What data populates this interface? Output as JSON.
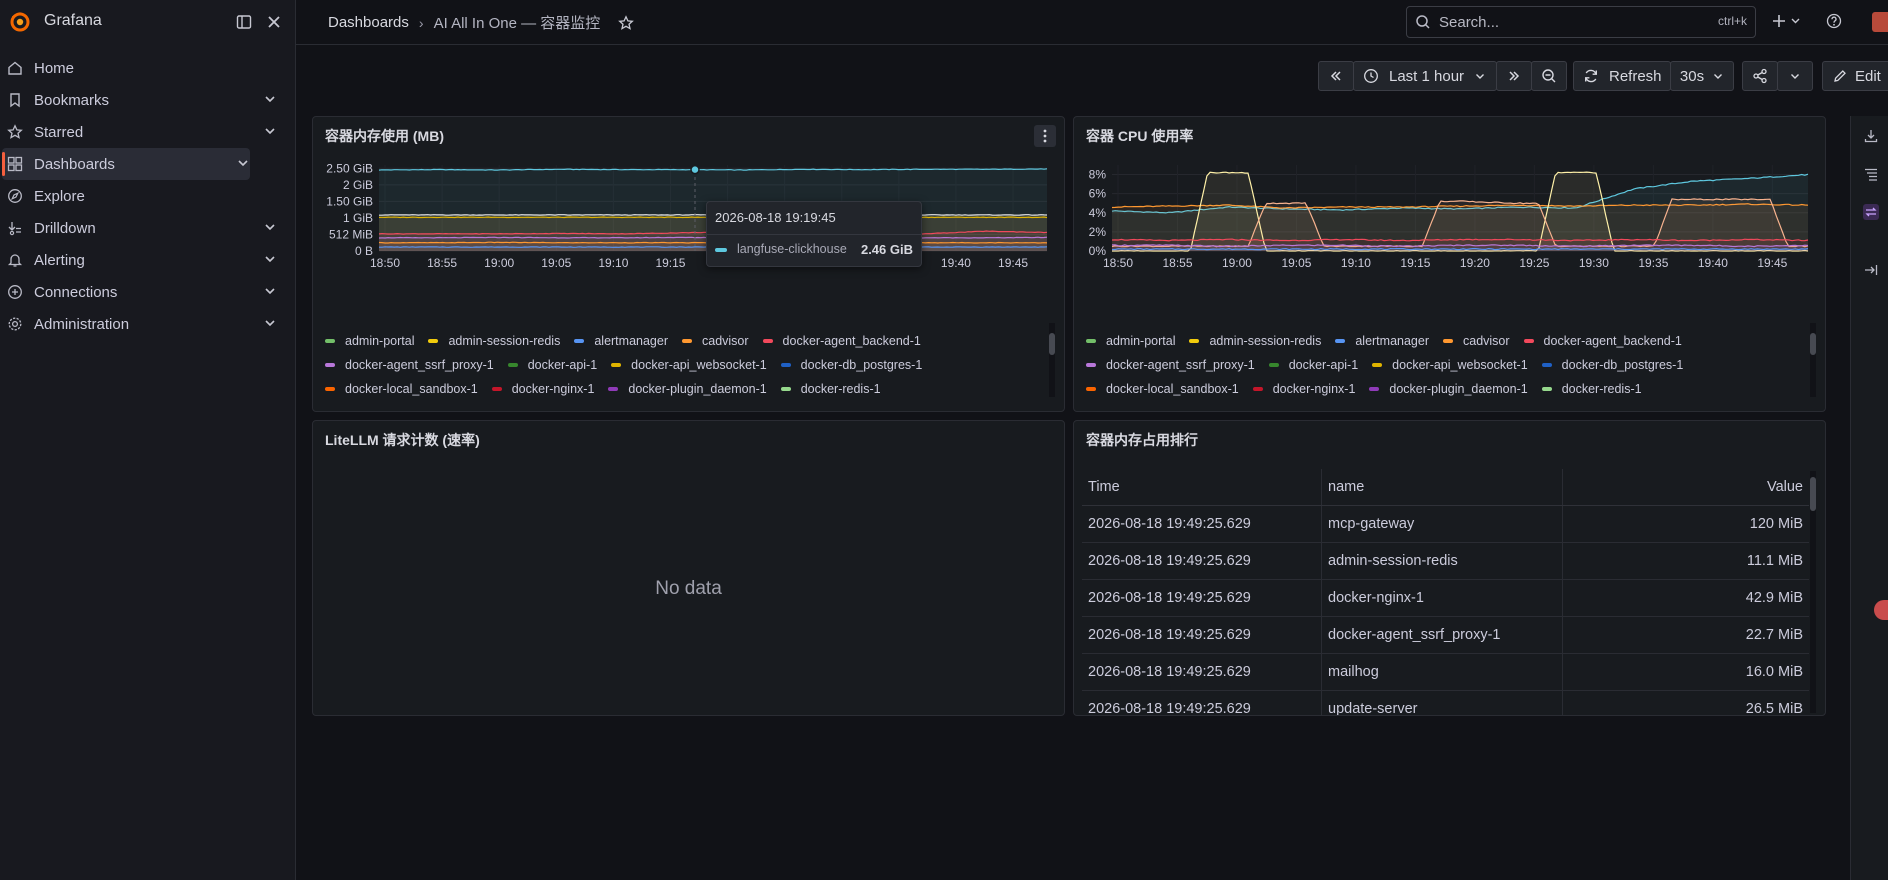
{
  "app": {
    "name": "Grafana"
  },
  "nav": {
    "items": [
      {
        "label": "Home",
        "icon": "home-icon",
        "expandable": false,
        "active": false
      },
      {
        "label": "Bookmarks",
        "icon": "bookmark-icon",
        "expandable": true,
        "active": false
      },
      {
        "label": "Starred",
        "icon": "star-icon",
        "expandable": true,
        "active": false
      },
      {
        "label": "Dashboards",
        "icon": "dashboards-grid-icon",
        "expandable": true,
        "active": true
      },
      {
        "label": "Explore",
        "icon": "compass-icon",
        "expandable": false,
        "active": false
      },
      {
        "label": "Drilldown",
        "icon": "drilldown-icon",
        "expandable": true,
        "active": false
      },
      {
        "label": "Alerting",
        "icon": "bell-icon",
        "expandable": true,
        "active": false
      },
      {
        "label": "Connections",
        "icon": "connections-icon",
        "expandable": true,
        "active": false
      },
      {
        "label": "Administration",
        "icon": "gear-icon",
        "expandable": true,
        "active": false
      }
    ]
  },
  "breadcrumb": {
    "parent": "Dashboards",
    "separator": "›",
    "current": "AI All In One — 容器监控"
  },
  "search": {
    "placeholder": "Search...",
    "shortcut": "ctrl+k"
  },
  "toolbar": {
    "time_range": "Last 1 hour",
    "refresh_label": "Refresh",
    "refresh_interval": "30s",
    "edit_label": "Edit"
  },
  "panels": {
    "memory": {
      "title": "容器内存使用 (MB)",
      "tooltip": {
        "time": "2026-08-18 19:19:45",
        "series": "langfuse-clickhouse",
        "value": "2.46 GiB"
      },
      "legend": [
        [
          "admin-portal",
          "admin-session-redis",
          "alertmanager",
          "cadvisor",
          "docker-agent_backend-1"
        ],
        [
          "docker-agent_ssrf_proxy-1",
          "docker-api-1",
          "docker-api_websocket-1",
          "docker-db_postgres-1"
        ],
        [
          "docker-local_sandbox-1",
          "docker-nginx-1",
          "docker-plugin_daemon-1",
          "docker-redis-1"
        ]
      ]
    },
    "cpu": {
      "title": "容器 CPU 使用率",
      "legend": [
        [
          "admin-portal",
          "admin-session-redis",
          "alertmanager",
          "cadvisor",
          "docker-agent_backend-1"
        ],
        [
          "docker-agent_ssrf_proxy-1",
          "docker-api-1",
          "docker-api_websocket-1",
          "docker-db_postgres-1"
        ],
        [
          "docker-local_sandbox-1",
          "docker-nginx-1",
          "docker-plugin_daemon-1",
          "docker-redis-1"
        ]
      ]
    },
    "litellm": {
      "title": "LiteLLM 请求计数 (速率)",
      "empty_text": "No data"
    },
    "ranking": {
      "title": "容器内存占用排行",
      "columns": [
        "Time",
        "name",
        "Value"
      ],
      "rows": [
        [
          "2026-08-18 19:49:25.629",
          "mcp-gateway",
          "120 MiB"
        ],
        [
          "2026-08-18 19:49:25.629",
          "admin-session-redis",
          "11.1 MiB"
        ],
        [
          "2026-08-18 19:49:25.629",
          "docker-nginx-1",
          "42.9 MiB"
        ],
        [
          "2026-08-18 19:49:25.629",
          "docker-agent_ssrf_proxy-1",
          "22.7 MiB"
        ],
        [
          "2026-08-18 19:49:25.629",
          "mailhog",
          "16.0 MiB"
        ],
        [
          "2026-08-18 19:49:25.629",
          "update-server",
          "26.5 MiB"
        ]
      ]
    }
  },
  "legend_colors": {
    "admin-portal": "#73bf69",
    "admin-session-redis": "#f2cc0c",
    "alertmanager": "#5794f2",
    "cadvisor": "#ff9830",
    "docker-agent_backend-1": "#f2495c",
    "docker-agent_ssrf_proxy-1": "#b877d9",
    "docker-api-1": "#37872d",
    "docker-api_websocket-1": "#e0b400",
    "docker-db_postgres-1": "#1f60c4",
    "docker-local_sandbox-1": "#fa6400",
    "docker-nginx-1": "#c4162a",
    "docker-plugin_daemon-1": "#8f3bb8",
    "docker-redis-1": "#96d98d"
  },
  "chart_data": [
    {
      "type": "line",
      "title": "容器内存使用 (MB)",
      "x_ticks": [
        "18:50",
        "18:55",
        "19:00",
        "19:05",
        "19:10",
        "19:15",
        "19:20",
        "19:25",
        "19:30",
        "19:35",
        "19:40",
        "19:45"
      ],
      "y_ticks": [
        "0 B",
        "512 MiB",
        "1 GiB",
        "1.50 GiB",
        "2 GiB",
        "2.50 GiB"
      ],
      "y_range_gib": [
        0,
        2.6
      ],
      "grid": true,
      "series": [
        {
          "name": "langfuse-clickhouse",
          "color": "#5ec8df",
          "values_gib": [
            2.45,
            2.46,
            2.45,
            2.47,
            2.46,
            2.46,
            2.45,
            2.47,
            2.46,
            2.47,
            2.47,
            2.48
          ]
        },
        {
          "name": "",
          "color": "#e6e6e6",
          "values_gib": [
            1.09,
            1.09,
            1.09,
            1.09,
            1.09,
            1.09,
            1.09,
            1.09,
            1.09,
            1.09,
            1.09,
            1.09
          ]
        },
        {
          "name": "",
          "color": "#e0b400",
          "values_gib": [
            1.02,
            1.02,
            1.02,
            1.02,
            1.02,
            1.02,
            1.02,
            1.02,
            1.02,
            1.02,
            1.02,
            1.02
          ]
        },
        {
          "name": "",
          "color": "#f2495c",
          "values_gib": [
            0.52,
            0.52,
            0.52,
            0.53,
            0.52,
            0.55,
            0.58,
            0.55,
            0.52,
            0.52,
            0.6,
            0.56
          ]
        },
        {
          "name": "",
          "color": "#b877d9",
          "values_gib": [
            0.4,
            0.4,
            0.41,
            0.4,
            0.4,
            0.41,
            0.4,
            0.4,
            0.41,
            0.4,
            0.4,
            0.41
          ]
        },
        {
          "name": "",
          "color": "#ff9830",
          "values_gib": [
            0.25,
            0.25,
            0.26,
            0.25,
            0.25,
            0.25,
            0.25,
            0.26,
            0.25,
            0.25,
            0.25,
            0.25
          ]
        },
        {
          "name": "",
          "color": "#5794f2",
          "values_gib": [
            0.12,
            0.12,
            0.12,
            0.12,
            0.12,
            0.12,
            0.12,
            0.12,
            0.12,
            0.12,
            0.12,
            0.12
          ]
        }
      ],
      "tooltip_point": {
        "x": "19:19:45",
        "y_gib": 2.46
      }
    },
    {
      "type": "line",
      "title": "容器 CPU 使用率",
      "x_ticks": [
        "18:50",
        "18:55",
        "19:00",
        "19:05",
        "19:10",
        "19:15",
        "19:20",
        "19:25",
        "19:30",
        "19:35",
        "19:40",
        "19:45"
      ],
      "y_ticks": [
        "0%",
        "2%",
        "4%",
        "6%",
        "8%"
      ],
      "y_range": [
        0,
        9
      ],
      "grid": true,
      "series": [
        {
          "name": "",
          "color": "#5ec8df",
          "values": [
            4.2,
            4.0,
            4.6,
            4.4,
            4.3,
            4.5,
            4.4,
            4.6,
            4.5,
            6.5,
            7.3,
            7.6,
            8.0
          ]
        },
        {
          "name": "",
          "color": "#ff9830",
          "values": [
            4.6,
            4.7,
            4.8,
            4.5,
            4.6,
            4.6,
            4.7,
            4.8,
            4.7,
            4.8,
            4.8,
            4.9,
            4.8
          ]
        },
        {
          "name": "",
          "color": "#fff1a8",
          "values": [
            0,
            0,
            8.2,
            0,
            0,
            0,
            0,
            0,
            8.2,
            0,
            0,
            0,
            0
          ]
        },
        {
          "name": "",
          "color": "#f8b38f",
          "values": [
            0.5,
            0.5,
            0.5,
            5.0,
            0.5,
            0.5,
            5.2,
            5.0,
            0.5,
            0.5,
            5.4,
            5.4,
            0.5
          ]
        },
        {
          "name": "",
          "color": "#f2495c",
          "values": [
            1.2,
            1.1,
            1.2,
            1.1,
            1.2,
            1.1,
            1.2,
            1.2,
            1.1,
            1.2,
            1.1,
            1.2,
            1.1
          ]
        },
        {
          "name": "",
          "color": "#b877d9",
          "values": [
            0.6,
            0.6,
            0.5,
            0.6,
            0.6,
            0.5,
            0.6,
            0.6,
            0.5,
            0.6,
            0.6,
            0.5,
            0.6
          ]
        },
        {
          "name": "",
          "color": "#5794f2",
          "values": [
            0.2,
            0.2,
            0.2,
            0.2,
            0.2,
            0.2,
            0.2,
            0.2,
            0.2,
            0.2,
            0.2,
            0.2,
            0.2
          ]
        }
      ]
    }
  ]
}
